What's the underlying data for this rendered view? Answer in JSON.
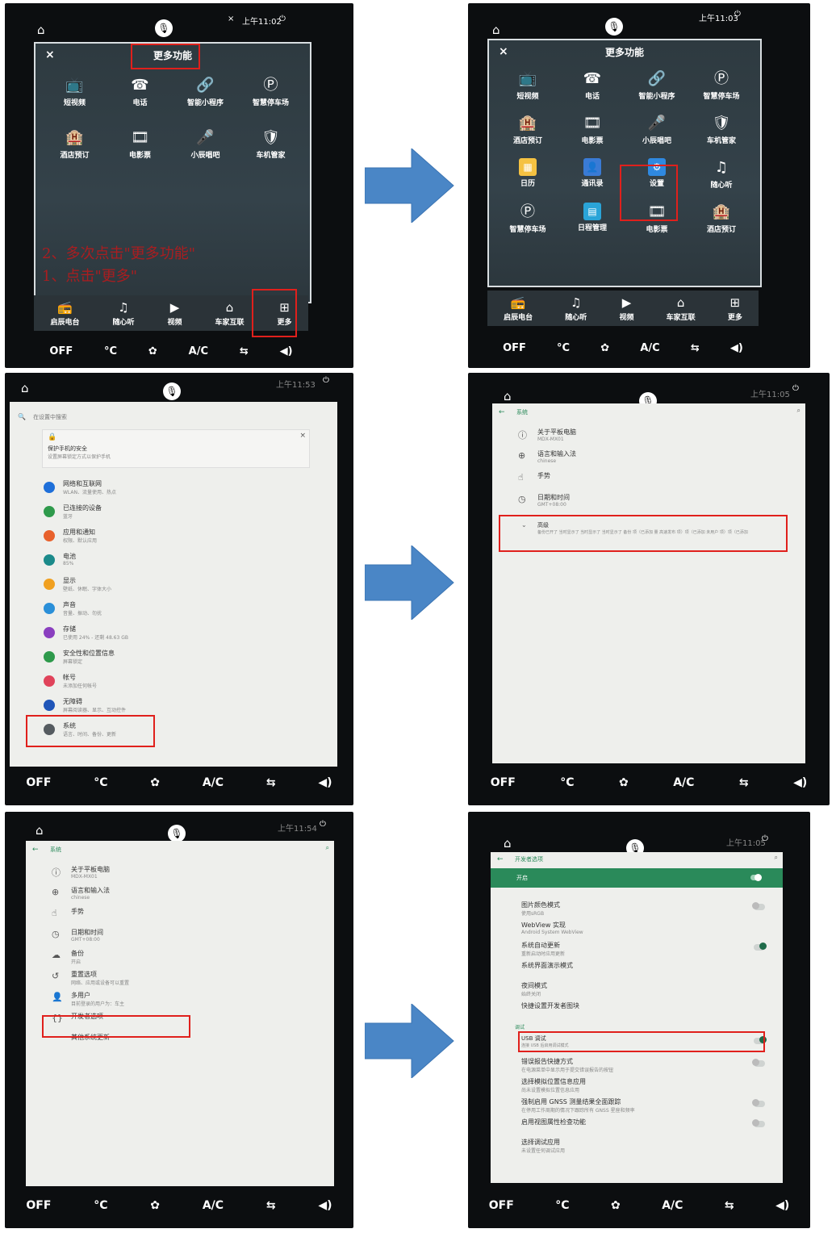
{
  "panel1": {
    "status_time": "上午11:02",
    "status_x": "×",
    "title": "更多功能",
    "close": "×",
    "grid_items": [
      {
        "icon": "tv-icon",
        "glyph": "📺",
        "label": "短视频"
      },
      {
        "icon": "phone-icon",
        "glyph": "☎",
        "label": "电话"
      },
      {
        "icon": "link-icon",
        "glyph": "🔗",
        "label": "智能小程序"
      },
      {
        "icon": "parking-icon",
        "glyph": "Ⓟ",
        "label": "智慧停车场"
      },
      {
        "icon": "hotel-icon",
        "glyph": "🏨",
        "label": "酒店预订"
      },
      {
        "icon": "film-icon",
        "glyph": "🎞",
        "label": "电影票"
      },
      {
        "icon": "mic-icon",
        "glyph": "🎤",
        "label": "小辰唱吧"
      },
      {
        "icon": "shield-icon",
        "glyph": "🛡",
        "label": "车机管家"
      }
    ],
    "annotation_line1": "2、多次点击\"更多功能\"",
    "annotation_line2": "1、点击\"更多\"",
    "dock": [
      {
        "icon": "radio-icon",
        "glyph": "📻",
        "label": "启辰电台"
      },
      {
        "icon": "music-icon",
        "glyph": "♫",
        "label": "随心听"
      },
      {
        "icon": "video-icon",
        "glyph": "▶",
        "label": "视频"
      },
      {
        "icon": "car-home-icon",
        "glyph": "⌂",
        "label": "车家互联"
      },
      {
        "icon": "more-grid-icon",
        "glyph": "⊞",
        "label": "更多"
      }
    ],
    "climate": [
      "OFF",
      "°C",
      "✿",
      "A/C",
      "⇆",
      "◀)"
    ]
  },
  "panel2": {
    "status_time": "上午11:03",
    "title": "更多功能",
    "close": "×",
    "grid_items": [
      {
        "icon": "tv-icon",
        "glyph": "📺",
        "label": "短视频"
      },
      {
        "icon": "phone-icon",
        "glyph": "☎",
        "label": "电话"
      },
      {
        "icon": "link-icon",
        "glyph": "🔗",
        "label": "智能小程序"
      },
      {
        "icon": "parking-icon",
        "glyph": "Ⓟ",
        "label": "智慧停车场"
      },
      {
        "icon": "hotel-icon",
        "glyph": "🏨",
        "label": "酒店预订"
      },
      {
        "icon": "film-icon",
        "glyph": "🎞",
        "label": "电影票"
      },
      {
        "icon": "mic-icon",
        "glyph": "🎤",
        "label": "小辰唱吧"
      },
      {
        "icon": "shield-icon",
        "glyph": "🛡",
        "label": "车机管家"
      },
      {
        "icon": "calendar-icon",
        "glyph": "▦",
        "label": "日历",
        "color": "#f5c242"
      },
      {
        "icon": "contacts-icon",
        "glyph": "👤",
        "label": "通讯录",
        "color": "#3a7bd5"
      },
      {
        "icon": "settings-icon",
        "glyph": "⚙",
        "label": "设置",
        "color": "#2f89e0"
      },
      {
        "icon": "music-icon",
        "glyph": "♫",
        "label": "随心听"
      },
      {
        "icon": "parking-icon",
        "glyph": "Ⓟ",
        "label": "智慧停车场"
      },
      {
        "icon": "schedule-icon",
        "glyph": "▤",
        "label": "日程管理",
        "color": "#2aa4d8"
      },
      {
        "icon": "film-icon",
        "glyph": "🎞",
        "label": "电影票"
      },
      {
        "icon": "hotel-icon",
        "glyph": "🏨",
        "label": "酒店预订"
      }
    ],
    "dock": [
      {
        "icon": "radio-icon",
        "glyph": "📻",
        "label": "启辰电台"
      },
      {
        "icon": "music-icon",
        "glyph": "♫",
        "label": "随心听"
      },
      {
        "icon": "video-icon",
        "glyph": "▶",
        "label": "视频"
      },
      {
        "icon": "car-home-icon",
        "glyph": "⌂",
        "label": "车家互联"
      },
      {
        "icon": "more-grid-icon",
        "glyph": "⊞",
        "label": "更多"
      }
    ],
    "climate": [
      "OFF",
      "°C",
      "✿",
      "A/C",
      "⇆",
      "◀)"
    ]
  },
  "panel3": {
    "status_time": "上午11:53",
    "search_placeholder": "在设置中搜索",
    "security_card_title": "保护手机的安全",
    "security_card_sub": "设置屏幕锁定方式以保护手机",
    "items": [
      {
        "title": "网络和互联网",
        "sub": "WLAN、流量使用、热点",
        "color": "#1e6fd9"
      },
      {
        "title": "已连接的设备",
        "sub": "蓝牙",
        "color": "#2e9a4b"
      },
      {
        "title": "应用和通知",
        "sub": "权限、默认应用",
        "color": "#e8612c"
      },
      {
        "title": "电池",
        "sub": "85%",
        "color": "#1b8a8a"
      },
      {
        "title": "显示",
        "sub": "壁纸、休眠、字体大小",
        "color": "#f0a020"
      },
      {
        "title": "声音",
        "sub": "音量、振动、勿扰",
        "color": "#2a8fd8"
      },
      {
        "title": "存储",
        "sub": "已使用 24% - 还剩 48.63 GB",
        "color": "#8a3fbf"
      },
      {
        "title": "安全性和位置信息",
        "sub": "屏幕锁定",
        "color": "#2e9a4b"
      },
      {
        "title": "帐号",
        "sub": "未添加任何帐号",
        "color": "#e0435a"
      },
      {
        "title": "无障碍",
        "sub": "屏幕阅读器、显示、互动控件",
        "color": "#1f55b8"
      },
      {
        "title": "系统",
        "sub": "语言、时间、备份、更新",
        "color": "#555b60"
      }
    ],
    "climate": [
      "OFF",
      "°C",
      "✿",
      "A/C",
      "⇆",
      "◀)"
    ]
  },
  "panel4": {
    "status_time": "上午11:05",
    "header": "系统",
    "items": [
      {
        "glyph": "ⓘ",
        "title": "关于平板电脑",
        "sub": "MDX-MX01"
      },
      {
        "glyph": "⊕",
        "title": "语言和输入法",
        "sub": "chinese"
      },
      {
        "glyph": "☝",
        "title": "手势",
        "sub": ""
      },
      {
        "glyph": "◷",
        "title": "日期和时间",
        "sub": "GMT+08:00"
      }
    ],
    "advanced_title": "高级",
    "advanced_sub": "备份已开了 当时显示了 当时显示了 当时显示了 备份 项（已添加 量 高速发布 项）项（已添加 未用户 项）项（已添加",
    "climate": [
      "OFF",
      "°C",
      "✿",
      "A/C",
      "⇆",
      "◀)"
    ]
  },
  "panel5": {
    "status_time": "上午11:54",
    "header": "系统",
    "items": [
      {
        "glyph": "ⓘ",
        "title": "关于平板电脑",
        "sub": "MDX-MX01"
      },
      {
        "glyph": "⊕",
        "title": "语言和输入法",
        "sub": "chinese"
      },
      {
        "glyph": "☝",
        "title": "手势",
        "sub": ""
      },
      {
        "glyph": "◷",
        "title": "日期和时间",
        "sub": "GMT+08:00"
      },
      {
        "glyph": "☁",
        "title": "备份",
        "sub": "开启"
      },
      {
        "glyph": "↺",
        "title": "重置选项",
        "sub": "网络、应用或设备可以重置"
      },
      {
        "glyph": "👤",
        "title": "多用户",
        "sub": "目前登录的用户为：车主"
      },
      {
        "glyph": "{}",
        "title": "开发者选项",
        "sub": ""
      },
      {
        "glyph": "",
        "title": "其他系统更新",
        "sub": ""
      }
    ],
    "climate": [
      "OFF",
      "°C",
      "✿",
      "A/C",
      "⇆",
      "◀)"
    ]
  },
  "panel6": {
    "status_time": "上午11:05",
    "header": "开发者选项",
    "master_label": "开启",
    "items": [
      {
        "title": "图片颜色模式",
        "sub": "使用sRGB",
        "toggle": "off"
      },
      {
        "title": "WebView 实现",
        "sub": "Android System WebView",
        "toggle": ""
      },
      {
        "title": "系统自动更新",
        "sub": "重新启动时应用更新",
        "toggle": "on"
      },
      {
        "title": "系统界面演示模式",
        "sub": "",
        "toggle": ""
      },
      {
        "title": "夜间模式",
        "sub": "始终关闭",
        "toggle": ""
      },
      {
        "title": "快捷设置开发者图块",
        "sub": "",
        "toggle": ""
      }
    ],
    "section": "调试",
    "usb_title": "USB 调试",
    "usb_sub": "连接 USB 后启用调试模式",
    "items2": [
      {
        "title": "错误报告快捷方式",
        "sub": "在电源菜单中显示用于提交错误报告的按钮",
        "toggle": "off"
      },
      {
        "title": "选择模拟位置信息应用",
        "sub": "尚未设置模拟位置信息应用",
        "toggle": ""
      },
      {
        "title": "强制启用 GNSS 测量结果全面跟踪",
        "sub": "在停用工作周期的情况下跟踪所有 GNSS 星座和频率",
        "toggle": "off"
      },
      {
        "title": "启用视图属性检查功能",
        "sub": "",
        "toggle": "off"
      },
      {
        "title": "选择调试应用",
        "sub": "未设置任何调试应用",
        "toggle": ""
      }
    ],
    "climate": [
      "OFF",
      "°C",
      "✿",
      "A/C",
      "⇆",
      "◀)"
    ]
  },
  "colors": {
    "red_box": "#e0201c",
    "arrow": "#4a86c6",
    "green_header": "#2a8a5a"
  }
}
